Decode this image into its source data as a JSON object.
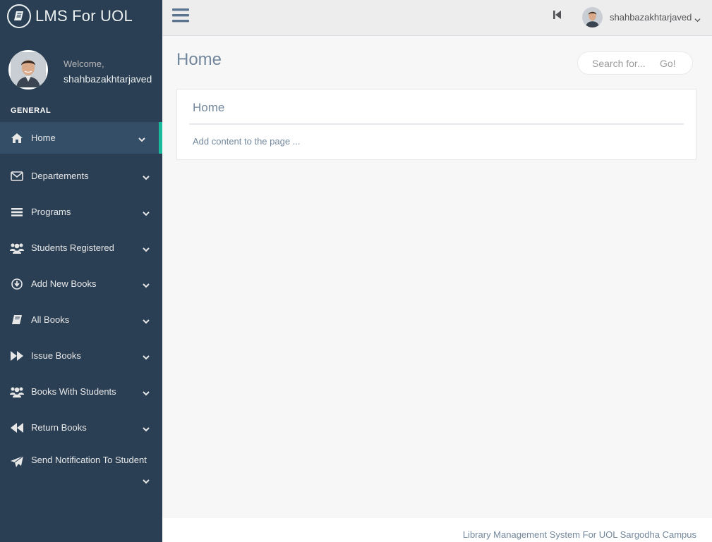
{
  "app": {
    "title": "LMS For UOL"
  },
  "profile": {
    "welcome": "Welcome,",
    "name": "shahbazakhtarjaved"
  },
  "sidebar": {
    "section_title": "GENERAL",
    "items": [
      {
        "label": "Home",
        "icon": "home-icon",
        "active": true
      },
      {
        "label": "Departements",
        "icon": "envelope-icon"
      },
      {
        "label": "Programs",
        "icon": "list-icon"
      },
      {
        "label": "Students Registered",
        "icon": "users-icon"
      },
      {
        "label": "Add New Books",
        "icon": "download-icon"
      },
      {
        "label": "All Books",
        "icon": "book-icon"
      },
      {
        "label": "Issue Books",
        "icon": "fast-forward-icon"
      },
      {
        "label": "Books With Students",
        "icon": "users-icon"
      },
      {
        "label": "Return Books",
        "icon": "backward-icon"
      },
      {
        "label": "Send Notification To Student",
        "icon": "paper-plane-icon"
      }
    ]
  },
  "topbar": {
    "user_name": "shahbazakhtarjaved"
  },
  "main": {
    "page_title": "Home",
    "search": {
      "placeholder": "Search for...",
      "button_label": "Go!"
    },
    "panel": {
      "title": "Home",
      "content": "Add content to the page ..."
    }
  },
  "footer": {
    "text": "Library Management System For UOL Sargodha Campus"
  },
  "colors": {
    "sidebar_bg": "#2A3F54",
    "active_item_bg": "#334E66",
    "accent": "#1ABB9C",
    "topbar_bg": "#EDEDED",
    "page_bg": "#F7F7F7"
  }
}
